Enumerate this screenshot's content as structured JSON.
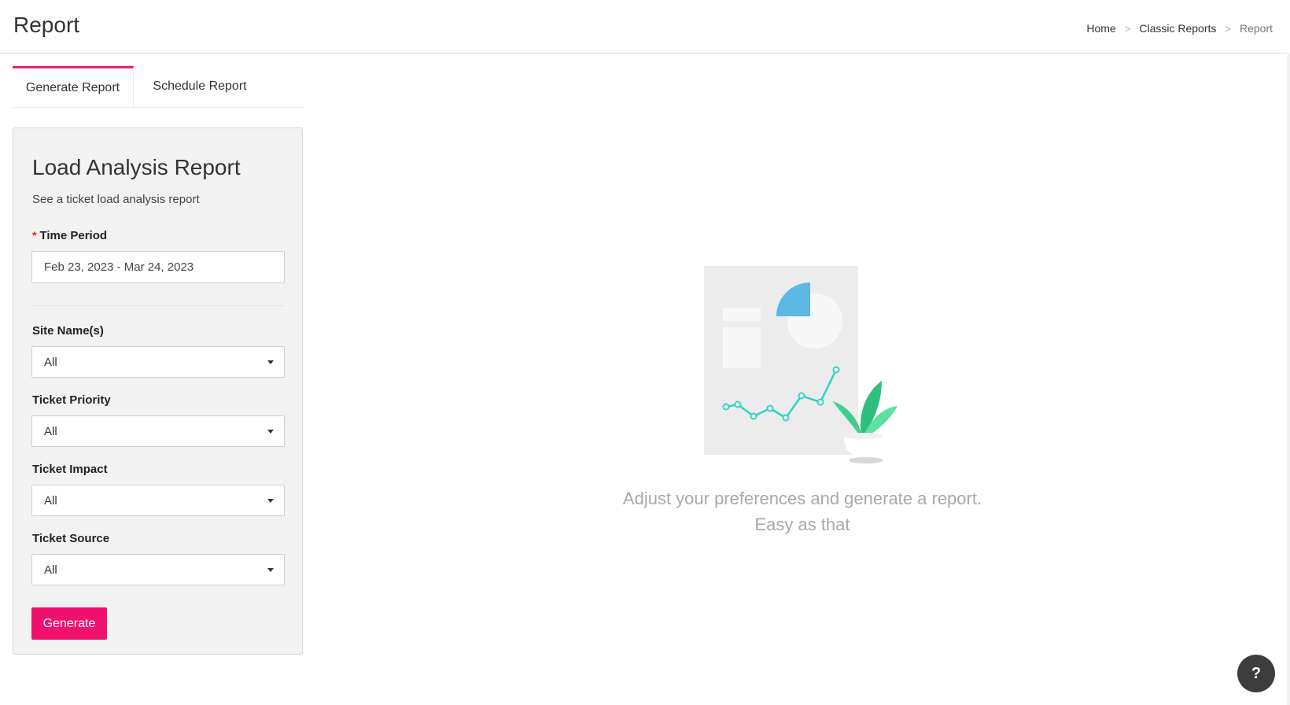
{
  "header": {
    "title": "Report",
    "breadcrumb": [
      "Home",
      "Classic Reports",
      "Report"
    ],
    "breadcrumb_separator": ">"
  },
  "tabs": [
    {
      "label": "Generate Report",
      "active": true
    },
    {
      "label": "Schedule Report",
      "active": false
    }
  ],
  "form": {
    "title": "Load Analysis Report",
    "description": "See a ticket load analysis report",
    "required_marker": "*",
    "time_period": {
      "label": "Time Period",
      "value": "Feb 23, 2023 - Mar 24, 2023"
    },
    "site_names": {
      "label": "Site Name(s)",
      "value": "All"
    },
    "ticket_priority": {
      "label": "Ticket Priority",
      "value": "All"
    },
    "ticket_impact": {
      "label": "Ticket Impact",
      "value": "All"
    },
    "ticket_source": {
      "label": "Ticket Source",
      "value": "All"
    },
    "generate_label": "Generate"
  },
  "empty_state": {
    "line1": "Adjust your preferences and generate a report.",
    "line2": "Easy as that"
  },
  "help": {
    "label": "?"
  },
  "colors": {
    "accent": "#f0116f",
    "tab_indicator": "#ec1e79",
    "required": "#e02020",
    "illustration_blue": "#5bb8e3",
    "illustration_teal": "#2dd4c4",
    "illustration_green": "#3ecf8e"
  }
}
